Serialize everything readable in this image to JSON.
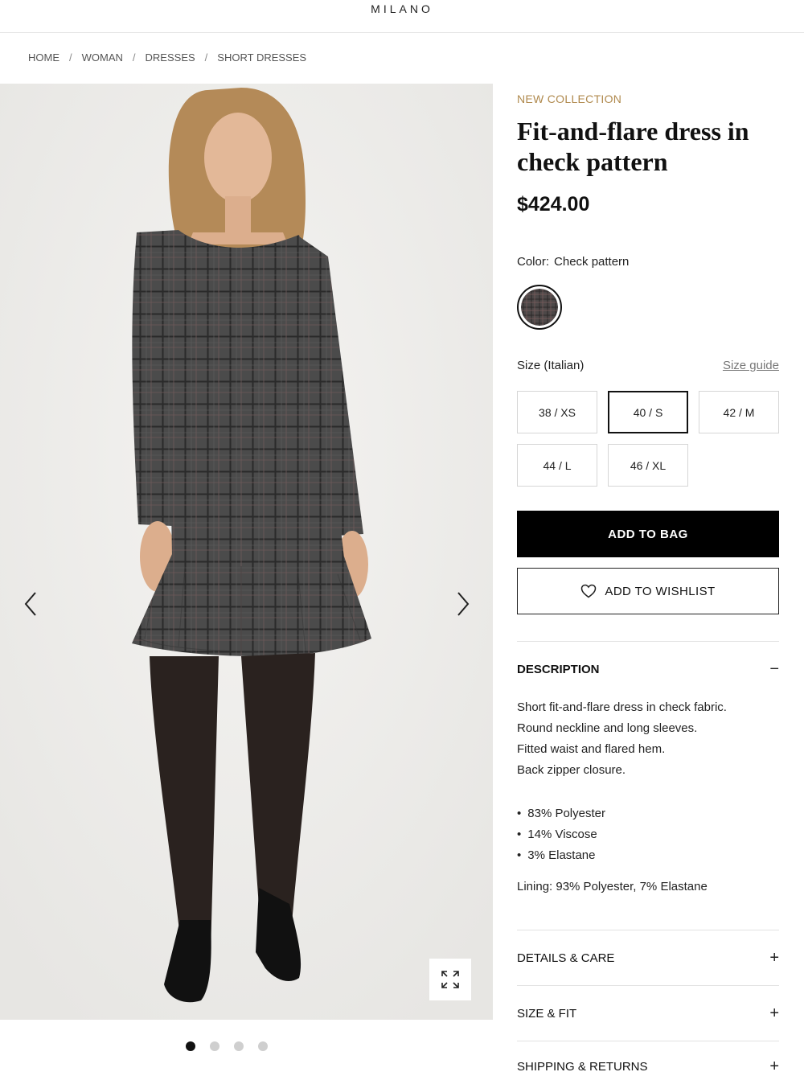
{
  "header": {
    "brand": "MILANO"
  },
  "breadcrumb": [
    "HOME",
    "WOMAN",
    "DRESSES",
    "SHORT DRESSES"
  ],
  "gallery": {
    "image_count": 4,
    "active_index": 0
  },
  "product": {
    "eyebrow": "NEW COLLECTION",
    "title": "Fit-and-flare dress in check pattern",
    "price": "$424.00",
    "color_label": "Color:",
    "color_value": "Check pattern",
    "size_label": "Size (Italian)",
    "size_guide": "Size guide",
    "sizes": [
      "38 / XS",
      "40 / S",
      "42 / M",
      "44 / L",
      "46 / XL"
    ],
    "selected_size": "40 / S",
    "add_to_bag": "ADD TO BAG",
    "add_to_wishlist": "ADD TO WISHLIST"
  },
  "description": {
    "heading": "DESCRIPTION",
    "toggle": "−",
    "lines": [
      "Short fit-and-flare dress in check fabric.",
      "Round neckline and long sleeves.",
      "Fitted waist and flared hem.",
      "Back zipper closure."
    ],
    "composition": [
      "83% Polyester",
      "14% Viscose",
      "3% Elastane"
    ],
    "lining": "Lining: 93% Polyester, 7% Elastane"
  },
  "accordions": [
    {
      "label": "DETAILS & CARE",
      "toggle": "+"
    },
    {
      "label": "SIZE & FIT",
      "toggle": "+"
    },
    {
      "label": "SHIPPING & RETURNS",
      "toggle": "+"
    }
  ],
  "colors": {
    "accent": "#b08a4e",
    "primary": "#000000",
    "dress": "#4a4a4a"
  }
}
